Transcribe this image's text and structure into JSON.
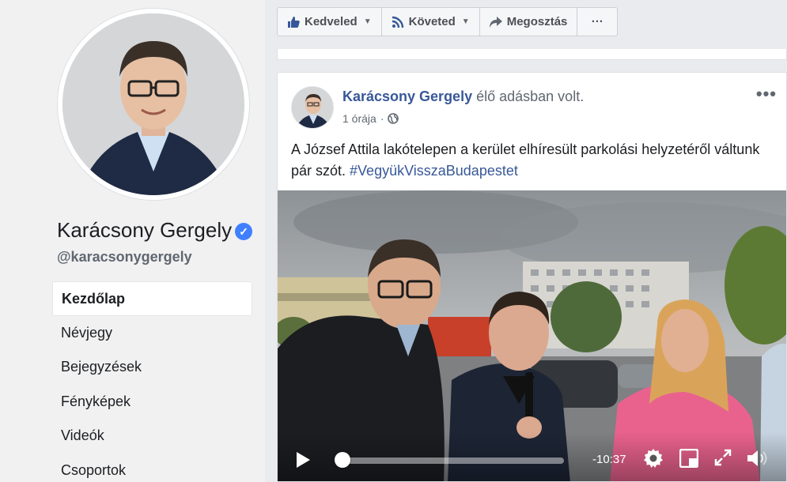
{
  "profile": {
    "name": "Karácsony Gergely",
    "handle": "@karacsonygergely",
    "verified_badge_icon": "verified-check-icon"
  },
  "nav": {
    "items": [
      {
        "label": "Kezdőlap",
        "active": true
      },
      {
        "label": "Névjegy"
      },
      {
        "label": "Bejegyzések"
      },
      {
        "label": "Fényképek"
      },
      {
        "label": "Videók"
      },
      {
        "label": "Csoportok"
      }
    ]
  },
  "toolbar": {
    "like_label": "Kedveled",
    "follow_label": "Követed",
    "share_label": "Megosztás",
    "more_label": "···"
  },
  "post": {
    "author": "Karácsony Gergely",
    "action": " élő adásban volt.",
    "time": "1 órája",
    "separator": "·",
    "text": "A József Attila lakótelepen a kerület elhíresült parkolási helyzetéről váltunk pár szót. ",
    "hashtag": "#VegyükVisszaBudapestet",
    "more_label": "•••"
  },
  "video": {
    "time_remaining": "-10:37",
    "progress": 0.0
  },
  "colors": {
    "link": "#385898",
    "accent": "#4080ff",
    "background": "#e9ebee"
  }
}
